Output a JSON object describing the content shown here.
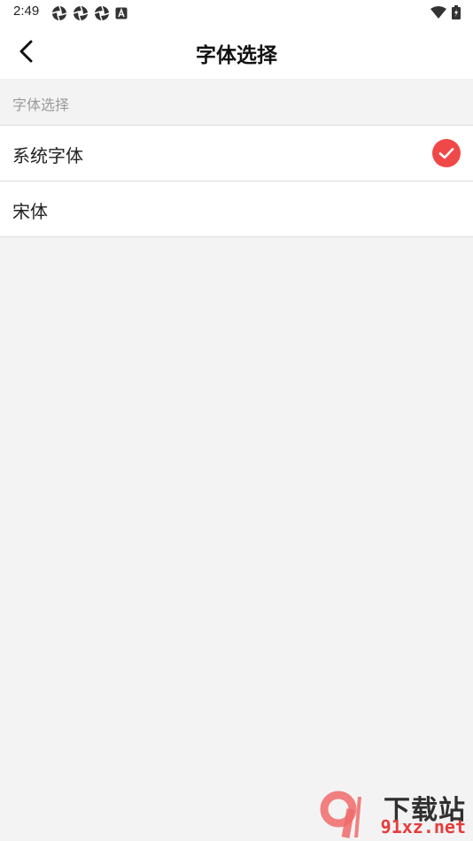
{
  "status_bar": {
    "time": "2:49",
    "left_icons": [
      "aperture-icon",
      "aperture-icon",
      "aperture-icon",
      "a-badge-icon"
    ],
    "right_icons": [
      "wifi-icon",
      "battery-icon"
    ]
  },
  "nav": {
    "title": "字体选择",
    "back_icon": "chevron-left-icon"
  },
  "section": {
    "label": "字体选择"
  },
  "fonts": [
    {
      "label": "系统字体",
      "selected": true
    },
    {
      "label": "宋体",
      "selected": false
    }
  ],
  "colors": {
    "accent": "#f04848",
    "background": "#f3f3f3",
    "divider": "#dcdcdc"
  },
  "watermark": {
    "top_text": "下载站",
    "bottom_text": "91xz.net"
  }
}
